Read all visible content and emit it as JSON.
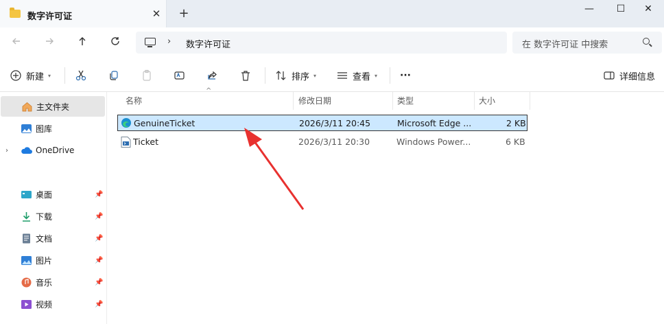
{
  "window": {
    "tab_title": "数字许可证",
    "tab_close": "✕",
    "new_tab": "+",
    "minimize": "—",
    "maximize": "☐",
    "close": "✕"
  },
  "navigation": {
    "back_icon": "arrow-left-icon",
    "forward_icon": "arrow-right-icon",
    "up_icon": "arrow-up-icon",
    "refresh_icon": "refresh-icon",
    "breadcrumb": [
      "数字许可证"
    ],
    "search_placeholder": "在 数字许可证 中搜索"
  },
  "toolbar": {
    "new_label": "新建",
    "sort_label": "排序",
    "view_label": "查看",
    "more_label": "···",
    "details_label": "详细信息"
  },
  "sidebar": {
    "home": "主文件夹",
    "gallery": "图库",
    "onedrive": "OneDrive",
    "quick_access": [
      {
        "label": "桌面",
        "pinned": true
      },
      {
        "label": "下载",
        "pinned": true
      },
      {
        "label": "文档",
        "pinned": true
      },
      {
        "label": "图片",
        "pinned": true
      },
      {
        "label": "音乐",
        "pinned": true
      },
      {
        "label": "视频",
        "pinned": true
      }
    ]
  },
  "file_list": {
    "columns": [
      "名称",
      "修改日期",
      "类型",
      "大小"
    ],
    "sort_indicator": "^",
    "rows": [
      {
        "name": "GenuineTicket",
        "modified": "2026/3/11 20:45",
        "type": "Microsoft Edge ...",
        "size": "2 KB",
        "icon": "edge-html-file-icon",
        "selected": true
      },
      {
        "name": "Ticket",
        "modified": "2026/3/11 20:30",
        "type": "Windows Power...",
        "size": "6 KB",
        "icon": "script-file-icon",
        "selected": false
      }
    ]
  },
  "colors": {
    "selection": "#cce8ff",
    "annotation_arrow": "#e8312f",
    "folder": "#f4c542",
    "accent": "#0067c0"
  }
}
